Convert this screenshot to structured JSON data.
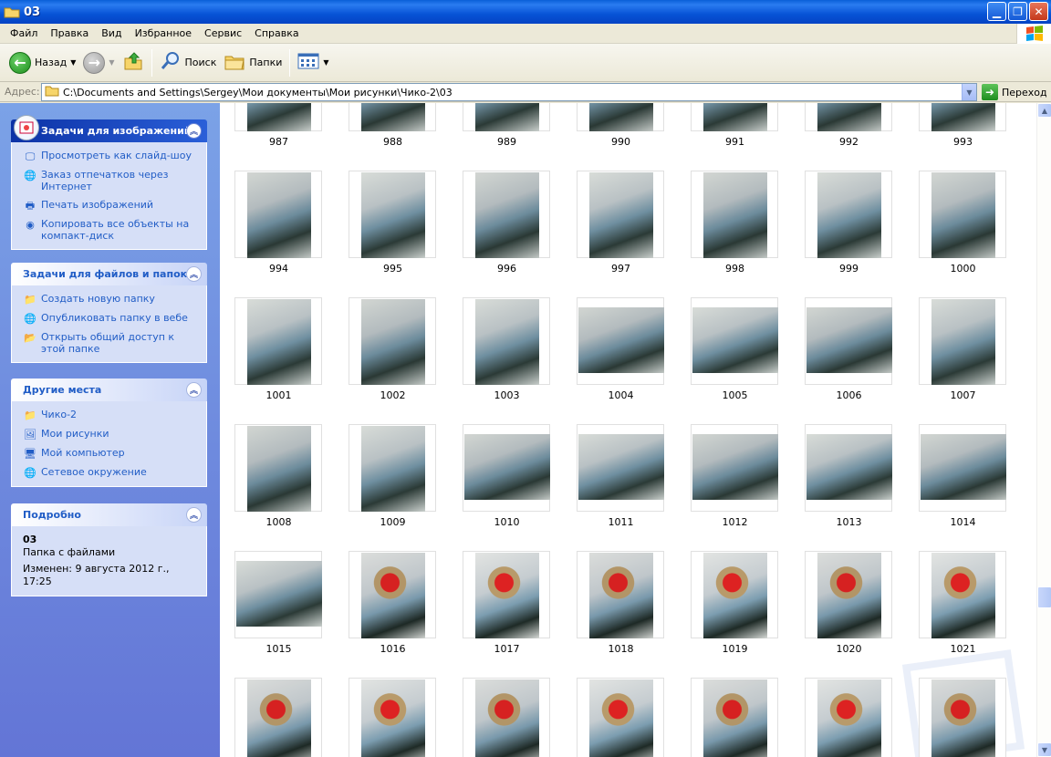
{
  "window": {
    "title": "03"
  },
  "menu": [
    "Файл",
    "Правка",
    "Вид",
    "Избранное",
    "Сервис",
    "Справка"
  ],
  "toolbar": {
    "back_label": "Назад",
    "search_label": "Поиск",
    "folders_label": "Папки"
  },
  "address": {
    "label": "Адрес:",
    "path": "C:\\Documents and Settings\\Sergey\\Мои документы\\Мои рисунки\\Чико-2\\03",
    "go_label": "Переход"
  },
  "left": {
    "image_tasks": {
      "title": "Задачи для изображений",
      "items": [
        {
          "label": "Просмотреть как слайд-шоу",
          "icon": "slideshow-icon"
        },
        {
          "label": "Заказ отпечатков через Интернет",
          "icon": "order-prints-icon"
        },
        {
          "label": "Печать изображений",
          "icon": "print-icon"
        },
        {
          "label": "Копировать все объекты на компакт-диск",
          "icon": "cd-copy-icon"
        }
      ]
    },
    "file_tasks": {
      "title": "Задачи для файлов и папок",
      "items": [
        {
          "label": "Создать новую папку",
          "icon": "new-folder-icon"
        },
        {
          "label": "Опубликовать папку в вебе",
          "icon": "publish-web-icon"
        },
        {
          "label": "Открыть общий доступ к этой папке",
          "icon": "share-folder-icon"
        }
      ]
    },
    "other_places": {
      "title": "Другие места",
      "items": [
        {
          "label": "Чико-2",
          "icon": "folder-icon"
        },
        {
          "label": "Мои рисунки",
          "icon": "my-pictures-icon"
        },
        {
          "label": "Мой компьютер",
          "icon": "my-computer-icon"
        },
        {
          "label": "Сетевое окружение",
          "icon": "network-icon"
        }
      ]
    },
    "details": {
      "title": "Подробно",
      "name": "03",
      "type": "Папка с файлами",
      "modified": "Изменен: 9 августа 2012 г., 17:25"
    }
  },
  "thumbnails": {
    "rows": [
      [
        "987",
        "988",
        "989",
        "990",
        "991",
        "992",
        "993"
      ],
      [
        "994",
        "995",
        "996",
        "997",
        "998",
        "999",
        "1000"
      ],
      [
        "1001",
        "1002",
        "1003",
        "1004",
        "1005",
        "1006",
        "1007"
      ],
      [
        "1008",
        "1009",
        "1010",
        "1011",
        "1012",
        "1013",
        "1014"
      ],
      [
        "1015",
        "1016",
        "1017",
        "1018",
        "1019",
        "1020",
        "1021"
      ],
      [
        "",
        "",
        "",
        "",
        "",
        "",
        ""
      ]
    ],
    "orientation": [
      [
        "p",
        "p",
        "p",
        "p",
        "p",
        "p",
        "p"
      ],
      [
        "p",
        "p",
        "p",
        "p",
        "p",
        "p",
        "p"
      ],
      [
        "p",
        "p",
        "p",
        "l",
        "l",
        "l",
        "p"
      ],
      [
        "p",
        "p",
        "l",
        "l",
        "l",
        "l",
        "l"
      ],
      [
        "l",
        "p",
        "p",
        "p",
        "p",
        "p",
        "p"
      ],
      [
        "p",
        "p",
        "p",
        "p",
        "p",
        "p",
        "p"
      ]
    ]
  },
  "colors": {
    "accent": "#215dc6",
    "title_bar": "#0753d6",
    "left_pane": "#6f8ddf"
  }
}
